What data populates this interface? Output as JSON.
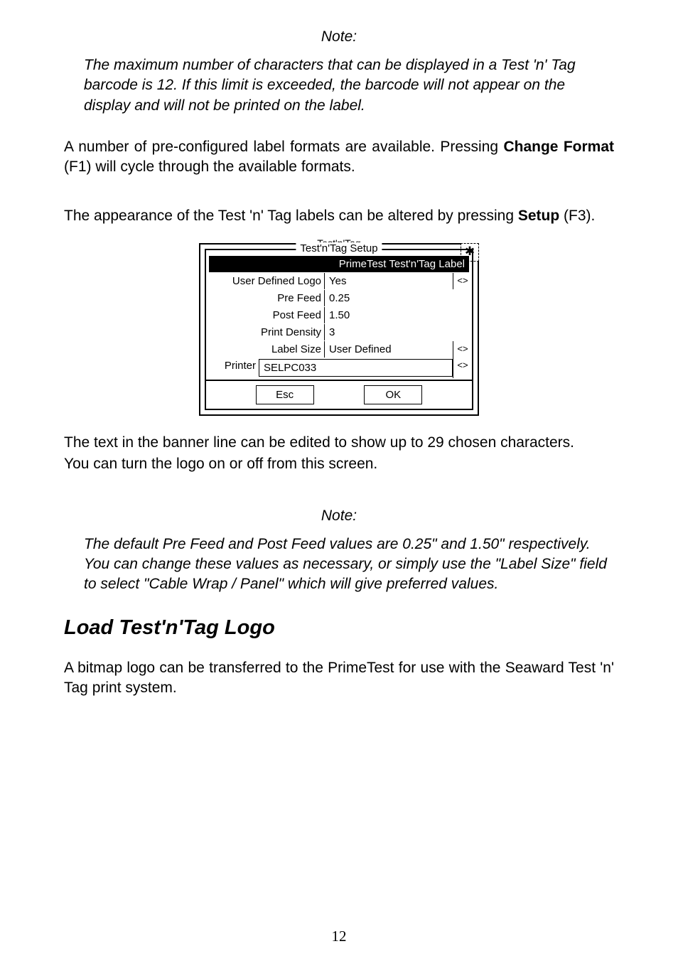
{
  "note1_label": "Note:",
  "note1_body": "The maximum number of characters that can be displayed in a Test 'n' Tag barcode is 12.  If this limit is exceeded, the barcode will not appear on the display and will not be printed on the label.",
  "para1_a": "A number of pre-configured label formats are available. Pressing ",
  "para1_b_bold": "Change Format",
  "para1_c": " (F1) will cycle through the available formats.",
  "para2_a": "The appearance of the Test 'n' Tag labels can be altered by pressing ",
  "para2_b_bold": "Setup",
  "para2_c": " (F3).",
  "ui": {
    "outer_title": "Test'n'Tag",
    "inner_title": "Test'n'Tag Setup",
    "bluetooth_icon": "✱",
    "banner": "PrimeTest Test'n'Tag Label",
    "rows": [
      {
        "label": "User Defined Logo",
        "value": "Yes",
        "arrow": "<>"
      },
      {
        "label": "Pre Feed",
        "value": "0.25"
      },
      {
        "label": "Post Feed",
        "value": "1.50"
      },
      {
        "label": "Print Density",
        "value": "3"
      },
      {
        "label": "Label Size",
        "value": "User Defined",
        "arrow": "<>"
      }
    ],
    "printer": {
      "label": "Printer",
      "value": "SELPC033",
      "arrow": "<>"
    },
    "buttons": {
      "esc": "Esc",
      "ok": "OK"
    }
  },
  "after_ui_1": " The text in the banner line can be edited to show up to 29 chosen characters.",
  "after_ui_2": "You can turn the logo on or off from this screen.",
  "note2_label": "Note:",
  "note2_body": "The default Pre Feed and Post Feed values are 0.25\" and 1.50\" respectively. You can change these values as necessary, or simply use the \"Label Size\" field to select \"Cable Wrap / Panel\" which will give preferred values.",
  "heading": "Load Test'n'Tag Logo",
  "para3": "A bitmap logo can be transferred to the PrimeTest for use with the Seaward Test 'n' Tag print system.",
  "page_number": "12"
}
